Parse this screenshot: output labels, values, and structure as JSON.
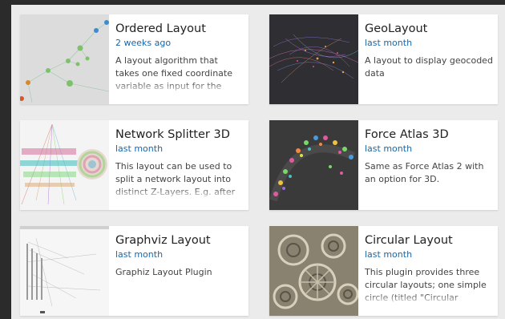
{
  "plugins": [
    {
      "title": "Ordered Layout",
      "date": "2 weeks ago",
      "description": "A layout algorithm that takes one fixed coordinate variable as input for the layout on one",
      "thumb_icon": "ordered-layout-thumbnail"
    },
    {
      "title": "GeoLayout",
      "date": "last month",
      "description": "A layout to display geocoded data",
      "thumb_icon": "geolayout-thumbnail"
    },
    {
      "title": "Network Splitter 3D",
      "date": "last month",
      "description": "This layout can be used to split a network layout into distinct Z-Layers. E.g. after",
      "thumb_icon": "network-splitter-thumbnail"
    },
    {
      "title": "Force Atlas 3D",
      "date": "last month",
      "description": "Same as Force Atlas 2 with an option for 3D.",
      "thumb_icon": "force-atlas-thumbnail"
    },
    {
      "title": "Graphviz Layout",
      "date": "last month",
      "description": "Graphiz Layout Plugin",
      "thumb_icon": "graphviz-thumbnail"
    },
    {
      "title": "Circular Layout",
      "date": "last month",
      "description": "This plugin provides three circular layouts; one simple circle (titled \"Circular Layout\",",
      "thumb_icon": "circular-layout-thumbnail"
    }
  ],
  "colors": {
    "link": "#1a66a8",
    "title": "#222222",
    "text": "#444444",
    "background": "#ebebeb",
    "frame": "#2b2b2b"
  }
}
